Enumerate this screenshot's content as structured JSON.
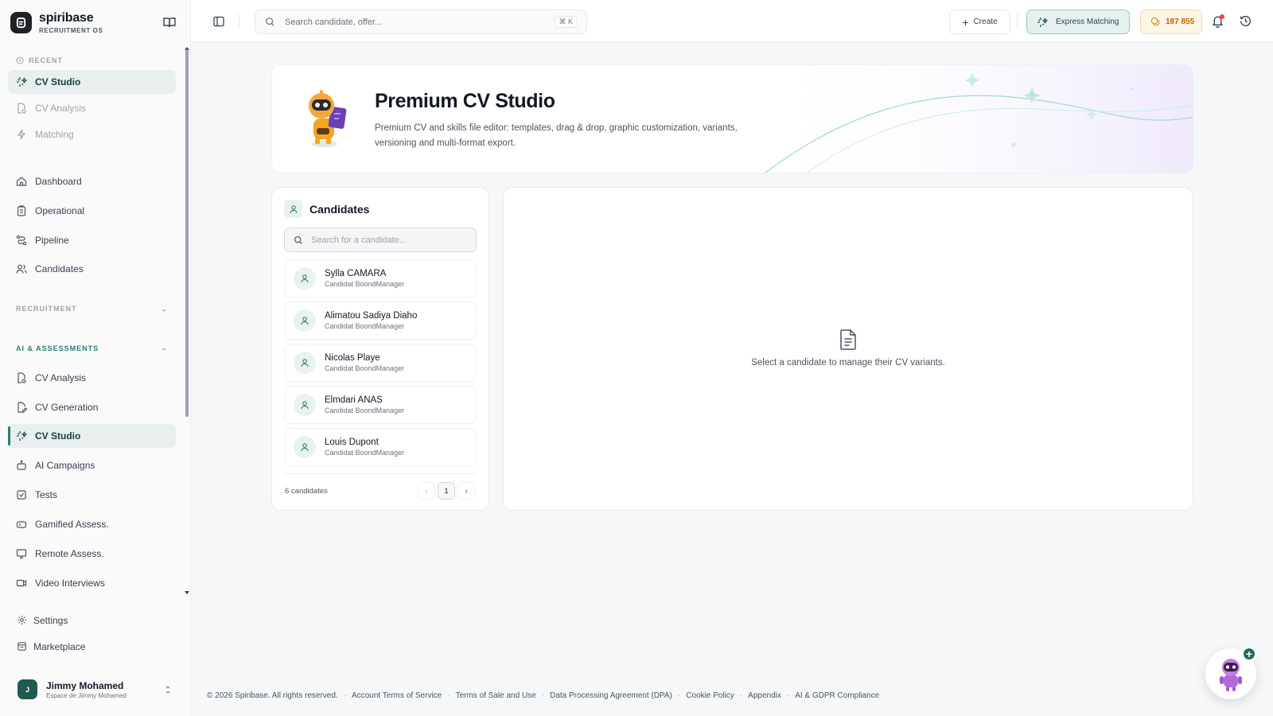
{
  "brand": {
    "name": "spiribase",
    "subtitle": "RECRUITMENT OS"
  },
  "sidebar": {
    "recent_label": "RECENT",
    "recent": [
      {
        "label": "CV Studio",
        "icon": "sparkles-icon",
        "state": "active"
      },
      {
        "label": "CV Analysis",
        "icon": "document-scan-icon",
        "state": "muted"
      },
      {
        "label": "Matching",
        "icon": "zap-icon",
        "state": "muted"
      }
    ],
    "main": [
      {
        "label": "Dashboard",
        "icon": "home-icon"
      },
      {
        "label": "Operational",
        "icon": "clipboard-icon"
      },
      {
        "label": "Pipeline",
        "icon": "route-icon"
      },
      {
        "label": "Candidates",
        "icon": "users-icon"
      }
    ],
    "recruitment_label": "RECRUITMENT",
    "ai_label": "AI & ASSESSMENTS",
    "ai_items": [
      {
        "label": "CV Analysis",
        "icon": "document-scan-icon"
      },
      {
        "label": "CV Generation",
        "icon": "document-edit-icon"
      },
      {
        "label": "CV Studio",
        "icon": "sparkles-icon",
        "state": "active"
      },
      {
        "label": "AI Campaigns",
        "icon": "bot-icon"
      },
      {
        "label": "Tests",
        "icon": "checkbox-icon"
      },
      {
        "label": "Gamified Assess.",
        "icon": "gamepad-icon"
      },
      {
        "label": "Remote Assess.",
        "icon": "monitor-icon"
      },
      {
        "label": "Video Interviews",
        "icon": "video-icon"
      }
    ],
    "bottom": [
      {
        "label": "Settings",
        "icon": "gear-icon"
      },
      {
        "label": "Marketplace",
        "icon": "store-icon"
      }
    ],
    "user": {
      "initial": "J",
      "name": "Jimmy Mohamed",
      "workspace": "Espace de Jimmy Mohamed"
    }
  },
  "topbar": {
    "search_placeholder": "Search candidate, offer...",
    "shortcut": "⌘ K",
    "create_label": "Create",
    "express_label": "Express Matching",
    "credits": "187 855"
  },
  "hero": {
    "title": "Premium CV Studio",
    "description": "Premium CV and skills file editor: templates, drag & drop, graphic customization, variants, versioning and multi-format export."
  },
  "candidates": {
    "title": "Candidates",
    "search_placeholder": "Search for a candidate...",
    "items": [
      {
        "name": "Sylla CAMARA",
        "source": "Candidat BoondManager"
      },
      {
        "name": "Alimatou Sadiya Diaho",
        "source": "Candidat BoondManager"
      },
      {
        "name": "Nicolas Playe",
        "source": "Candidat BoondManager"
      },
      {
        "name": "Elmdari ANAS",
        "source": "Candidat BoondManager"
      },
      {
        "name": "Louis Dupont",
        "source": "Candidat BoondManager"
      }
    ],
    "count_label": "6 candidates",
    "page": "1",
    "prev": "‹",
    "next": "›"
  },
  "detail": {
    "empty_message": "Select a candidate to manage their CV variants."
  },
  "footer": {
    "copyright": "© 2026 Spiribase. All rights reserved.",
    "links": [
      "Account Terms of Service",
      "Terms of Sale and Use",
      "Data Processing Agreement (DPA)",
      "Cookie Policy",
      "Appendix",
      "AI & GDPR Compliance"
    ]
  },
  "colors": {
    "accent": "#2e7d74",
    "active_bg": "#e8efee",
    "credits": "#b86a00",
    "danger": "#ef4444"
  }
}
